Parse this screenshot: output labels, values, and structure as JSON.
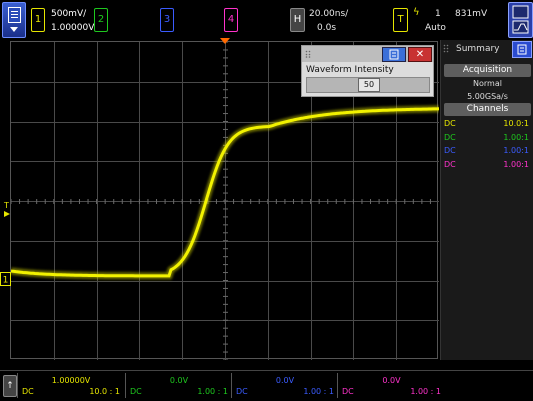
{
  "top": {
    "ch1": {
      "num": "1",
      "scale": "500mV/",
      "offset": "1.00000V"
    },
    "ch2": {
      "num": "2"
    },
    "ch3": {
      "num": "3"
    },
    "ch4": {
      "num": "4"
    },
    "horizontal": {
      "badge": "H",
      "timebase": "20.00ns/",
      "delay": "0.0s"
    },
    "trigger": {
      "badge": "T",
      "edge_glyph": "ϟ",
      "source": "1",
      "level": "831mV",
      "mode": "Auto"
    }
  },
  "dialog": {
    "title_label": "Waveform Intensity",
    "value": "50",
    "close": "✕"
  },
  "summary": {
    "title": "Summary",
    "acquisition_header": "Acquisition",
    "acq_mode": "Normal",
    "sample_rate": "5.00GSa/s",
    "channels_header": "Channels",
    "channels": [
      {
        "coupling": "DC",
        "probe": "10.0:1",
        "color": "#e6e600"
      },
      {
        "coupling": "DC",
        "probe": "1.00:1",
        "color": "#1ec81e"
      },
      {
        "coupling": "DC",
        "probe": "1.00:1",
        "color": "#3b5cff"
      },
      {
        "coupling": "DC",
        "probe": "1.00:1",
        "color": "#ff33cc"
      }
    ]
  },
  "marker": {
    "trigger_label": "T"
  },
  "bottom": {
    "arrow": "↑",
    "cells": [
      {
        "offset": "1.00000V",
        "coupling": "DC",
        "probe": "10.0 : 1",
        "color": "#e6e600"
      },
      {
        "offset": "0.0V",
        "coupling": "DC",
        "probe": "1.00 : 1",
        "color": "#1ec81e"
      },
      {
        "offset": "0.0V",
        "coupling": "DC",
        "probe": "1.00 : 1",
        "color": "#3b5cff"
      },
      {
        "offset": "0.0V",
        "coupling": "DC",
        "probe": "1.00 : 1",
        "color": "#ff33cc"
      }
    ]
  }
}
